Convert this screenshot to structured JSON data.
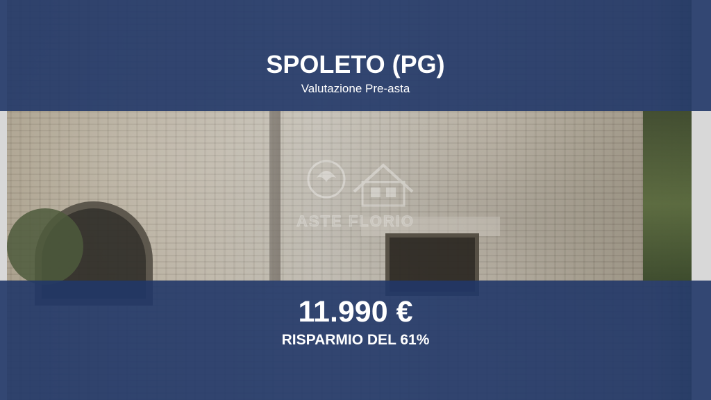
{
  "header": {
    "title": "SPOLETO (PG)",
    "subtitle": "Valutazione Pre-asta"
  },
  "offer": {
    "price": "11.990 €",
    "savings": "RISPARMIO DEL 61%"
  },
  "watermark": {
    "text": "ASTE FLORIO"
  },
  "colors": {
    "band": "#213768",
    "text": "#ffffff"
  }
}
